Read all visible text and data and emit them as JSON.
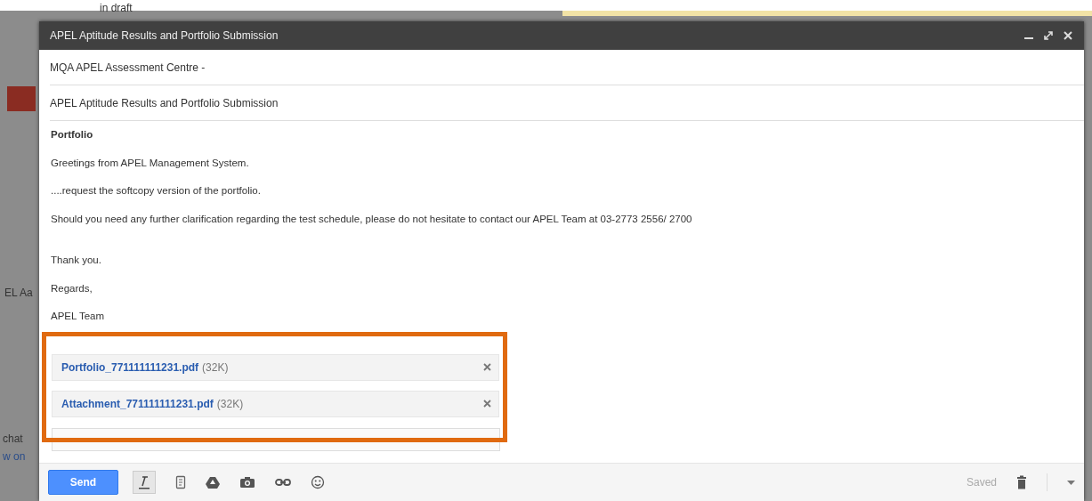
{
  "background": {
    "texts": [
      {
        "text": "in draft",
        "kind": "top"
      },
      {
        "text": "EL Aa",
        "kind": "side"
      },
      {
        "text": "chat",
        "kind": "side"
      },
      {
        "text": "w on",
        "kind": "link"
      }
    ]
  },
  "window": {
    "title": "APEL Aptitude Results and Portfolio Submission"
  },
  "recipients": "MQA APEL Assessment Centre -",
  "subject": "APEL Aptitude Results and Portfolio Submission",
  "body": [
    {
      "text": "Portfolio",
      "kind": "heading"
    },
    {
      "text": "Greetings from APEL Management System.",
      "kind": "line"
    },
    {
      "text": "....request the softcopy version of the portfolio.",
      "kind": "line"
    },
    {
      "text": "Should you need any further clarification regarding the test schedule, please do not hesitate to contact our APEL Team at 03-2773 2556/ 2700",
      "kind": "line"
    },
    {
      "text": "Thank you.",
      "kind": "gap"
    },
    {
      "text": "Regards,",
      "kind": "line"
    },
    {
      "text": "APEL Team",
      "kind": "line"
    }
  ],
  "attachments": [
    {
      "name": "Portfolio_771111111231.pdf",
      "size": "(32K)"
    },
    {
      "name": "Attachment_771111111231.pdf",
      "size": "(32K)"
    }
  ],
  "send_button": "Send",
  "status": "Saved"
}
